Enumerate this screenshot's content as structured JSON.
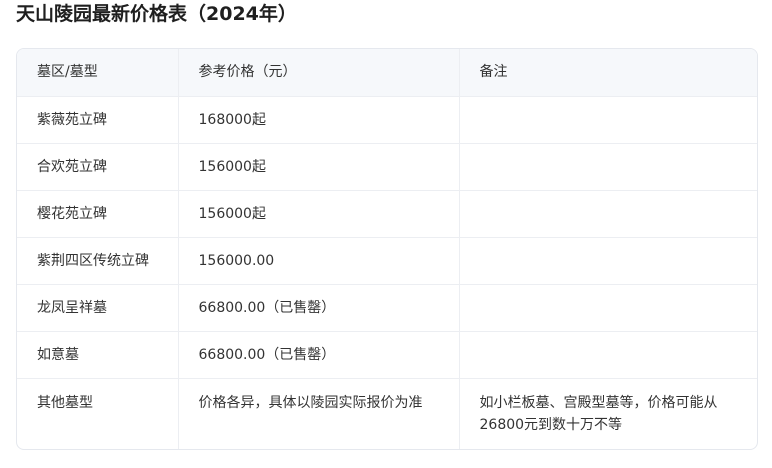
{
  "title": "天山陵园最新价格表（2024年）",
  "table": {
    "headers": [
      "墓区/墓型",
      "参考价格（元）",
      "备注"
    ],
    "rows": [
      [
        "紫薇苑立碑",
        "168000起",
        ""
      ],
      [
        "合欢苑立碑",
        "156000起",
        ""
      ],
      [
        "樱花苑立碑",
        "156000起",
        ""
      ],
      [
        "紫荆四区传统立碑",
        "156000.00",
        ""
      ],
      [
        "龙凤呈祥墓",
        "66800.00（已售罄）",
        ""
      ],
      [
        "如意墓",
        "66800.00（已售罄）",
        ""
      ],
      [
        "其他墓型",
        "价格各异，具体以陵园实际报价为准",
        "如小栏板墓、宫殿型墓等，价格可能从26800元到数十万不等"
      ]
    ]
  }
}
